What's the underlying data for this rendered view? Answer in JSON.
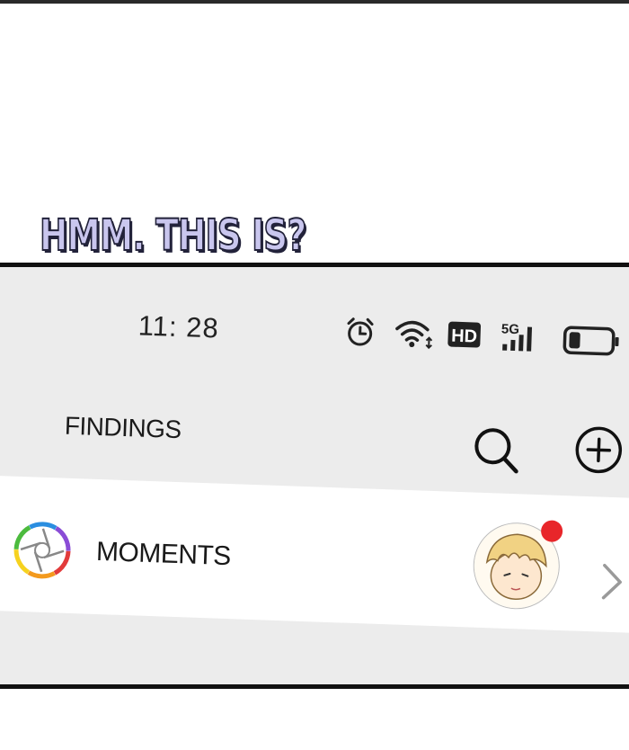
{
  "caption": {
    "text": "HMM. THIS IS?"
  },
  "status_bar": {
    "time": "11: 28",
    "hd_label": "HD",
    "network_label": "5G",
    "icons": [
      "alarm-icon",
      "wifi-icon",
      "hd-icon",
      "signal-5g-icon",
      "battery-icon"
    ]
  },
  "header": {
    "title": "FINDINGS",
    "icons": [
      "search-icon",
      "add-icon"
    ]
  },
  "moments": {
    "label": "MOMENTS",
    "icons": [
      "moments-logo-icon",
      "chevron-right-icon"
    ],
    "badge_color": "#e8262a"
  },
  "colors": {
    "caption_fill": "#c9c6ee",
    "caption_outline": "#22223a",
    "phone_bg": "#ececec"
  }
}
